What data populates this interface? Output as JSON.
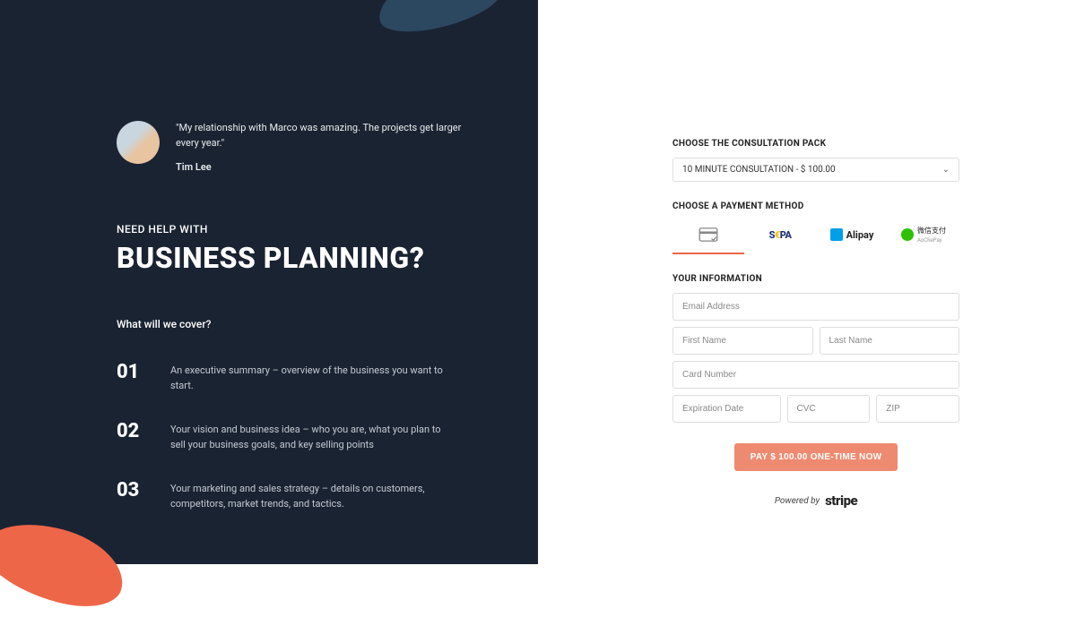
{
  "left": {
    "quote": "\"My relationship with Marco was amazing. The projects get larger every year.\"",
    "author": "Tim Lee",
    "subhead": "NEED HELP WITH",
    "heading": "BUSINESS PLANNING?",
    "cover_q": "What will we cover?",
    "items": [
      {
        "num": "01",
        "desc": "An executive summary – overview of the business you want to start."
      },
      {
        "num": "02",
        "desc": "Your vision and business idea – who you are, what you plan to sell your business goals, and key selling points"
      },
      {
        "num": "03",
        "desc": "Your marketing and sales strategy – details on customers, competitors, market trends, and tactics."
      }
    ]
  },
  "right": {
    "pack_label": "CHOOSE THE CONSULTATION PACK",
    "pack_value": "10 MINUTE CONSULTATION - $ 100.00",
    "method_label": "CHOOSE A PAYMENT METHOD",
    "methods": {
      "sepa_a": "S",
      "sepa_b": "€",
      "sepa_c": "PA",
      "alipay": "Alipay",
      "wechat": "微信支付",
      "wechat_sub": "AoChePay"
    },
    "info_label": "YOUR INFORMATION",
    "fields": {
      "email": "Email Address",
      "first": "First Name",
      "last": "Last Name",
      "card": "Card Number",
      "exp": "Expiration Date",
      "cvc": "CVC",
      "zip": "ZIP"
    },
    "pay_button": "PAY $ 100.00 ONE-TIME NOW",
    "powered": "Powered by",
    "stripe": "stripe"
  }
}
